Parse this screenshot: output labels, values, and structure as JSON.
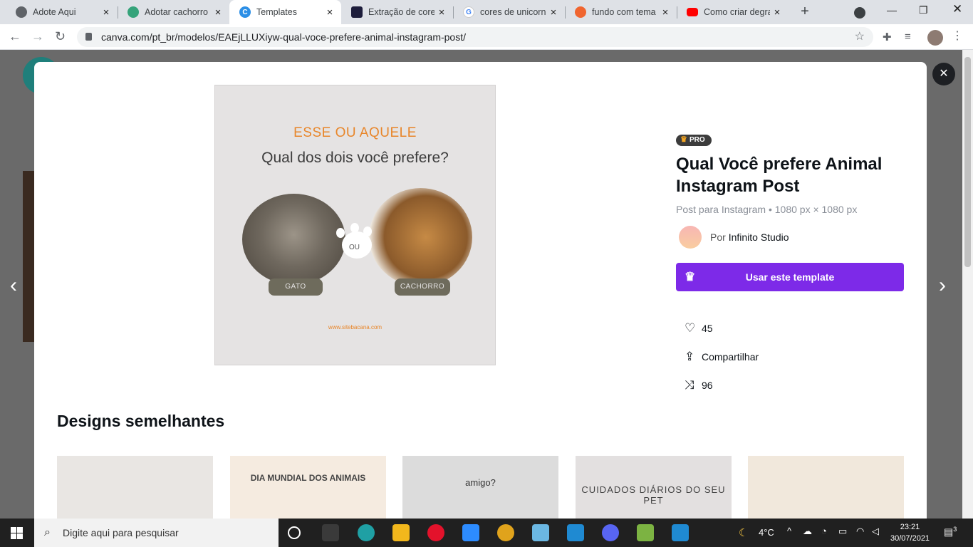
{
  "browser": {
    "tabs": [
      {
        "title": "Adote Aqui",
        "icon": "globe-icon"
      },
      {
        "title": "Adotar cachorro",
        "icon": "paw-icon"
      },
      {
        "title": "Templates",
        "icon": "canva-icon"
      },
      {
        "title": "Extração de cores",
        "icon": "extraction-icon"
      },
      {
        "title": "cores de unicorni",
        "icon": "google-icon"
      },
      {
        "title": "fundo com tema",
        "icon": "brave-icon"
      },
      {
        "title": "Como criar degra",
        "icon": "youtube-icon"
      }
    ],
    "url": "canva.com/pt_br/modelos/EAEjLLUXiyw-qual-voce-prefere-animal-instagram-post/"
  },
  "template_preview": {
    "eyebrow": "ESSE OU AQUELE",
    "question": "Qual dos dois você prefere?",
    "connector": "OU",
    "left_label": "GATO",
    "right_label": "CACHORRO",
    "site": "www.sitebacana.com"
  },
  "details": {
    "badge": "PRO",
    "title": "Qual Você prefere Animal Instagram Post",
    "subtitle": "Post para Instagram • 1080 px × 1080 px",
    "author_prefix": "Por",
    "author_name": "Infinito Studio",
    "use_button": "Usar este template",
    "likes": "45",
    "share": "Compartilhar",
    "remix": "96"
  },
  "similar": {
    "heading": "Designs semelhantes",
    "cards": [
      {
        "caption": ""
      },
      {
        "caption": "DIA MUNDIAL DOS ANIMAIS"
      },
      {
        "caption": "amigo?"
      },
      {
        "caption": "CUIDADOS DIÁRIOS DO SEU PET"
      },
      {
        "caption": ""
      }
    ]
  },
  "taskbar": {
    "search_placeholder": "Digite aqui para pesquisar",
    "weather": "4°C",
    "time": "23:21",
    "date": "30/07/2021",
    "notifications": "3"
  },
  "colors": {
    "accent": "#7d2ae8",
    "template_orange": "#e8862a"
  }
}
